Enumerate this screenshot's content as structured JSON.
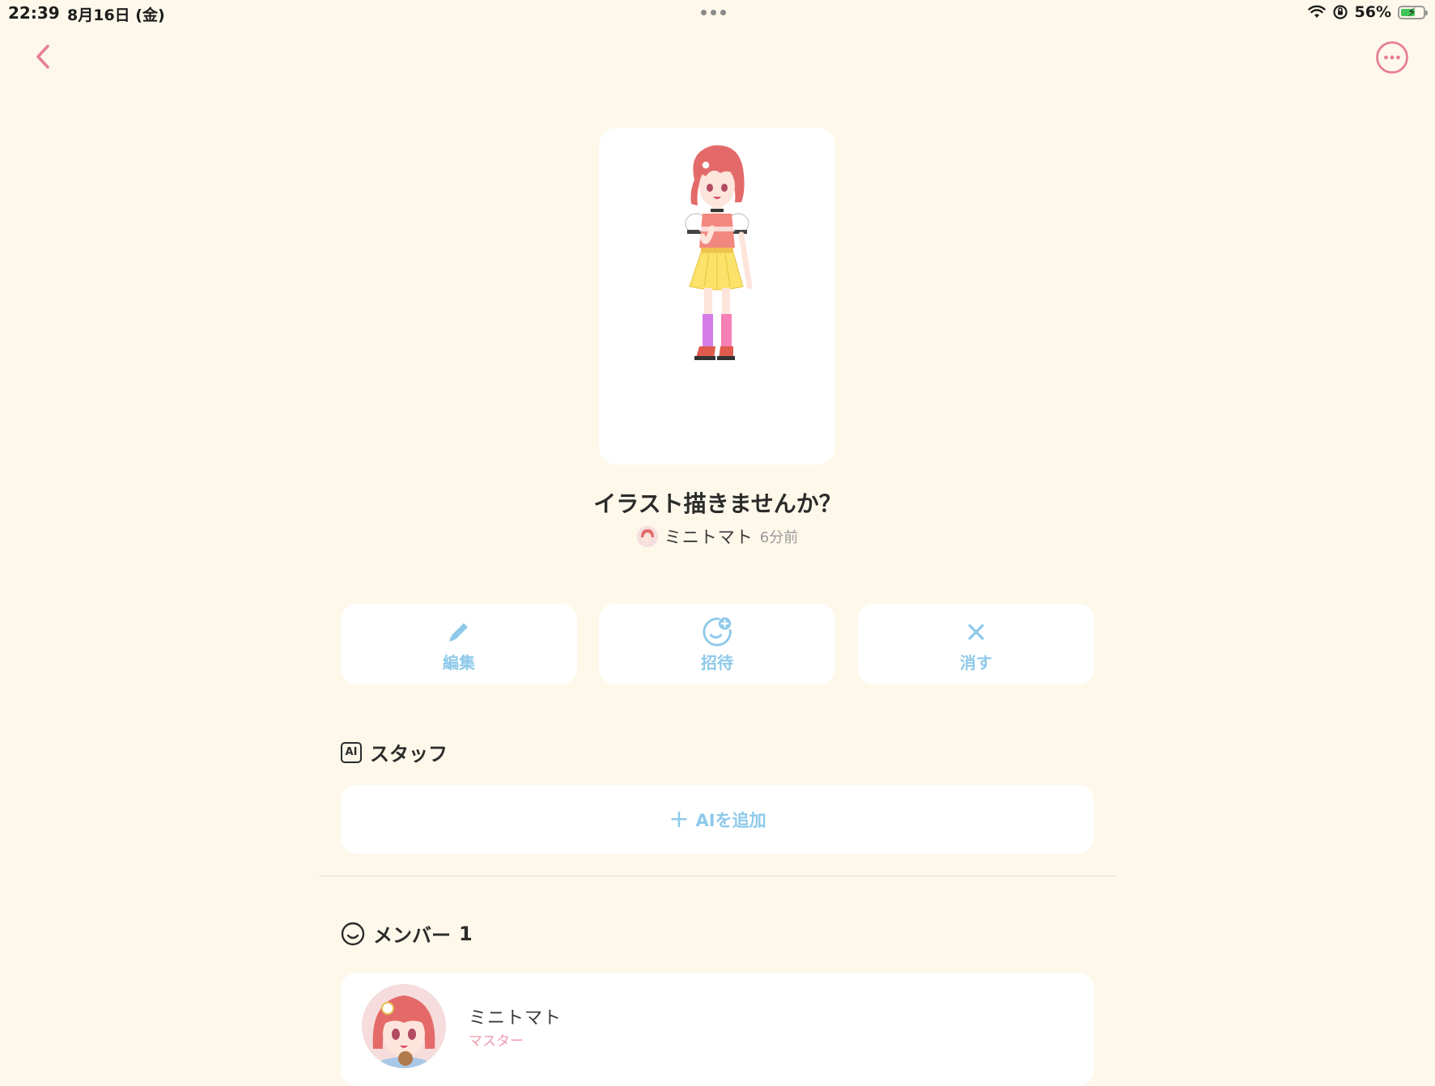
{
  "status_bar": {
    "time": "22:39",
    "date": "8月16日 (金)",
    "battery": "56%"
  },
  "nav": {
    "back_icon": "chevron-left-icon",
    "more_icon": "ellipsis-circle-icon",
    "accent_color": "#e97f93"
  },
  "post": {
    "title": "イラスト描きませんか？",
    "author": "ミニトマト",
    "time_ago": "6分前"
  },
  "actions": [
    {
      "label": "編集",
      "icon": "pencil-icon"
    },
    {
      "label": "招待",
      "icon": "invite-face-icon"
    },
    {
      "label": "消す",
      "icon": "close-icon"
    }
  ],
  "staff": {
    "title": "スタッフ",
    "badge": "AI",
    "add_label": "AIを追加"
  },
  "members": {
    "title": "メンバー",
    "count": "1",
    "list": [
      {
        "name": "ミニトマト",
        "role": "マスター"
      }
    ]
  },
  "colors": {
    "background": "#fdf8ea",
    "button_text": "#8ec9ea",
    "role_text": "#f09aae"
  }
}
